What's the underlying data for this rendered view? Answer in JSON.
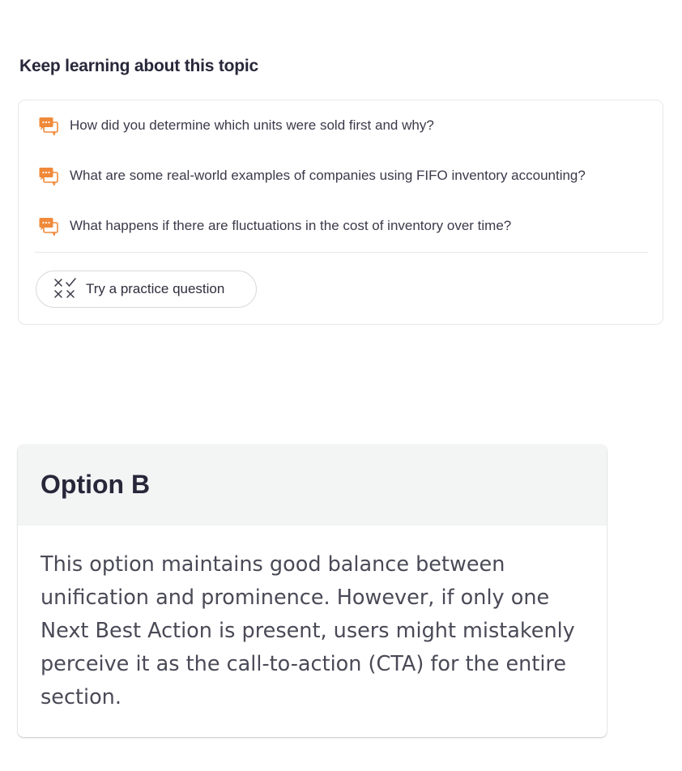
{
  "learning": {
    "title": "Keep learning about this topic",
    "questions": [
      {
        "text": "How did you determine which units were sold first and why?",
        "icon": "chat-bubbles-icon"
      },
      {
        "text": "What are some real-world examples of companies using FIFO inventory accounting?",
        "icon": "chat-bubbles-icon"
      },
      {
        "text": "What happens if there are fluctuations in the cost of inventory over time?",
        "icon": "chat-bubbles-icon"
      }
    ],
    "practice_button": {
      "label": "Try a practice question",
      "icon": "practice-quiz-icon"
    }
  },
  "option": {
    "title": "Option B",
    "body": "This option maintains good balance between unification and prominence. However, if only one Next Best Action is present, users might mistakenly perceive it as the call-to-action (CTA) for the entire section."
  },
  "colors": {
    "accent_orange": "#f08a3a",
    "text_dark": "#28273a",
    "header_bg": "#f3f4f4",
    "border": "#e6e7ea"
  }
}
